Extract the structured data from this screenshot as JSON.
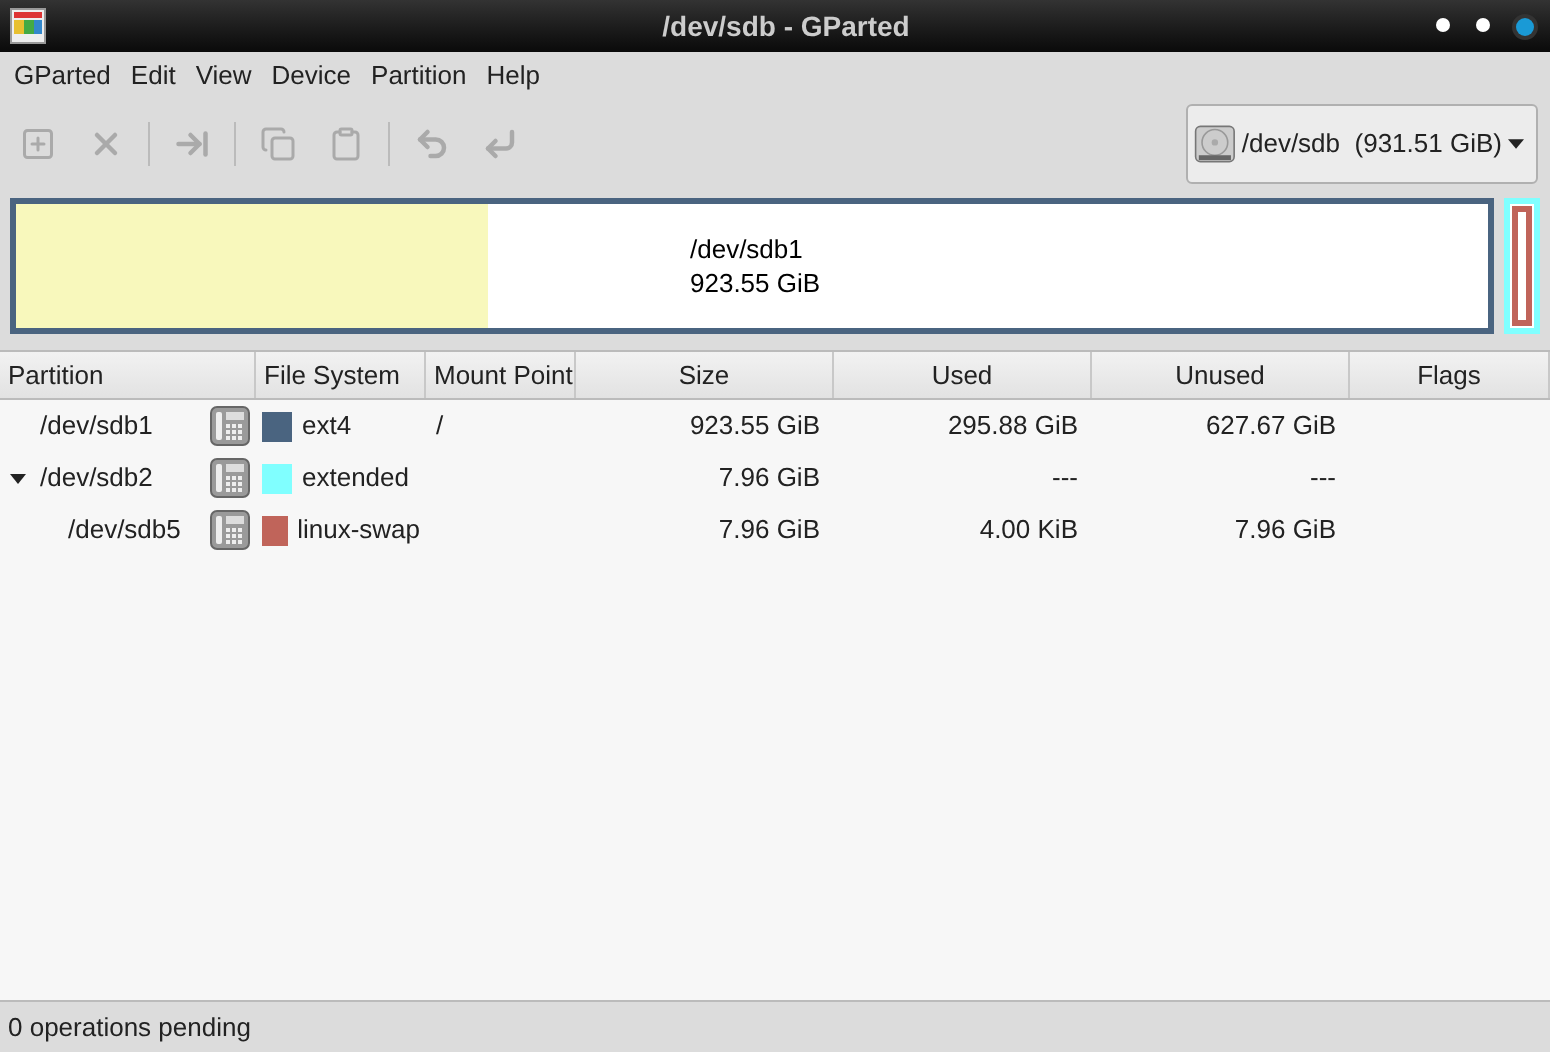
{
  "window": {
    "title": "/dev/sdb - GParted"
  },
  "menu": [
    "GParted",
    "Edit",
    "View",
    "Device",
    "Partition",
    "Help"
  ],
  "device_selector": {
    "name": "/dev/sdb",
    "size": "(931.51 GiB)"
  },
  "disk_map": [
    {
      "kind": "primary",
      "label": "/dev/sdb1",
      "size": "923.55 GiB",
      "color": "#4a6480",
      "level": 0.32
    },
    {
      "kind": "extended",
      "color": "#80ffff",
      "children": [
        {
          "kind": "logical",
          "color": "#c0645a"
        }
      ]
    }
  ],
  "table": {
    "columns": [
      "Partition",
      "File System",
      "Mount Point",
      "Size",
      "Used",
      "Unused",
      "Flags"
    ],
    "rows": [
      {
        "partition": "/dev/sdb1",
        "file_system": "ext4",
        "color": "#4a6480",
        "mount_point": "/",
        "size": "923.55 GiB",
        "used": "295.88 GiB",
        "unused": "627.67 GiB"
      },
      {
        "partition": "/dev/sdb2",
        "file_system": "extended",
        "color": "#80ffff",
        "size": "7.96 GiB",
        "used": "---",
        "unused": "---",
        "expanded": true,
        "children": [
          {
            "partition": "/dev/sdb5",
            "file_system": "linux-swap",
            "color": "#c0645a",
            "size": "7.96 GiB",
            "used": "4.00 KiB",
            "unused": "7.96 GiB"
          }
        ]
      }
    ]
  },
  "status_bar": "0 operations pending"
}
